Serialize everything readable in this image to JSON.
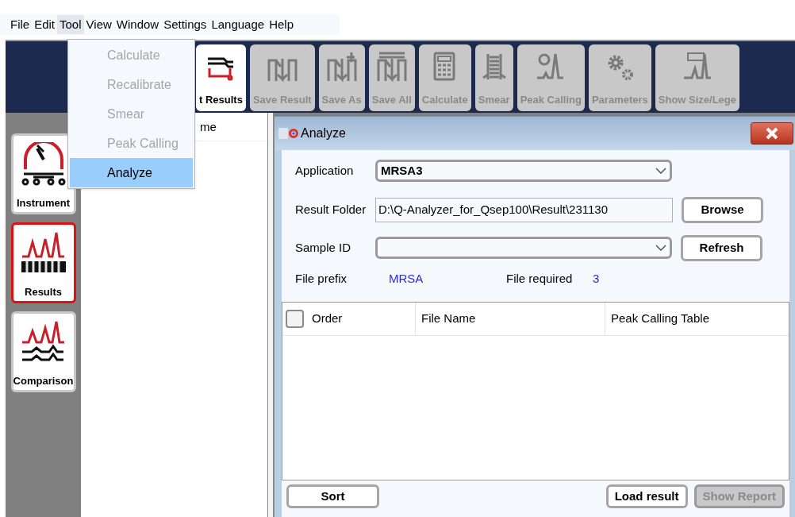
{
  "menubar": [
    {
      "label": "File",
      "selected": false
    },
    {
      "label": "Edit",
      "selected": false
    },
    {
      "label": "Tool",
      "selected": true
    },
    {
      "label": "View",
      "selected": false
    },
    {
      "label": "Window",
      "selected": false
    },
    {
      "label": "Settings",
      "selected": false
    },
    {
      "label": "Language",
      "selected": false
    },
    {
      "label": "Help",
      "selected": false
    }
  ],
  "tool_menu": [
    {
      "label": "Calculate",
      "disabled": true,
      "selected": false
    },
    {
      "label": "Recalibrate",
      "disabled": true,
      "selected": false
    },
    {
      "label": "Smear",
      "disabled": true,
      "selected": false
    },
    {
      "label": "Peak Calling",
      "disabled": true,
      "selected": false
    },
    {
      "label": "Analyze",
      "disabled": false,
      "selected": true
    }
  ],
  "toolbar": [
    {
      "label": "t Results",
      "kind": "import",
      "disabled": false
    },
    {
      "label": "Save Result",
      "kind": "save",
      "disabled": true
    },
    {
      "label": "Save As",
      "kind": "saveas",
      "disabled": true
    },
    {
      "label": "Save All",
      "kind": "saveall",
      "disabled": true
    },
    {
      "label": "Calculate",
      "kind": "calculate",
      "disabled": true
    },
    {
      "label": "Smear",
      "kind": "smear",
      "disabled": true
    },
    {
      "label": "Peak Calling",
      "kind": "peak",
      "disabled": true
    },
    {
      "label": "Parameters",
      "kind": "parameters",
      "disabled": true
    },
    {
      "label": "Show Size/Lege",
      "kind": "size",
      "disabled": true
    }
  ],
  "sidebar": [
    {
      "label": "Instrument",
      "kind": "gauge",
      "selected": false
    },
    {
      "label": "Results",
      "kind": "barcode",
      "selected": true
    },
    {
      "label": "Comparison",
      "kind": "compare",
      "selected": false
    }
  ],
  "list_panel": {
    "header": "me"
  },
  "dialog": {
    "title": "Analyze",
    "application": {
      "label": "Application",
      "value": "MRSA3"
    },
    "result_folder": {
      "label": "Result Folder",
      "value": "D:\\Q-Analyzer_for_Qsep100\\Result\\231130",
      "button": "Browse"
    },
    "sample_id": {
      "label": "Sample ID",
      "button": "Refresh"
    },
    "file_prefix": {
      "label": "File prefix",
      "value": "MRSA"
    },
    "file_required": {
      "label": "File required",
      "value": "3"
    },
    "table": {
      "select_all_checked": false,
      "columns": [
        "Order",
        "File Name",
        "Peak Calling Table"
      ]
    },
    "footer_left": [
      {
        "label": "Sort",
        "disabled": false
      }
    ],
    "footer_right": [
      {
        "label": "Load result",
        "disabled": false
      },
      {
        "label": "Show Report",
        "disabled": true
      }
    ]
  }
}
